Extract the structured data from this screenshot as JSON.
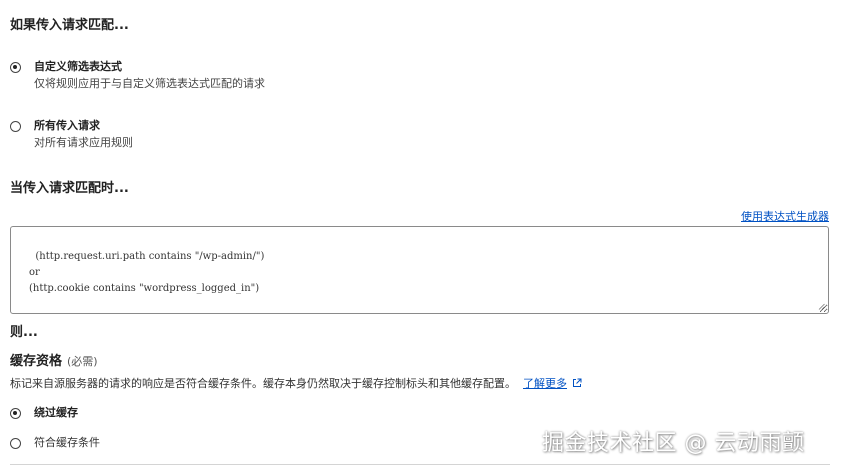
{
  "match_section": {
    "title": "如果传入请求匹配...",
    "options": [
      {
        "label": "自定义筛选表达式",
        "description": "仅将规则应用于与自定义筛选表达式匹配的请求",
        "checked": true
      },
      {
        "label": "所有传入请求",
        "description": "对所有请求应用规则",
        "checked": false
      }
    ]
  },
  "when_section": {
    "title": "当传入请求匹配时...",
    "builder_link": "使用表达式生成器",
    "expression": "(http.request.uri.path contains \"/wp-admin/\")\nor\n(http.cookie contains \"wordpress_logged_in\")"
  },
  "then_section": {
    "title": "则...",
    "field_label": "缓存资格",
    "field_required": "(必需)",
    "field_help": "标记来自源服务器的请求的响应是否符合缓存条件。缓存本身仍然取决于缓存控制标头和其他缓存配置。",
    "learn_more": "了解更多",
    "options": [
      {
        "label": "绕过缓存",
        "checked": true
      },
      {
        "label": "符合缓存条件",
        "checked": false
      }
    ]
  },
  "watermark": "掘金技术社区 @ 云动雨颤",
  "colors": {
    "link": "#0051c3",
    "border": "#8a8a8a",
    "text": "#222222"
  }
}
